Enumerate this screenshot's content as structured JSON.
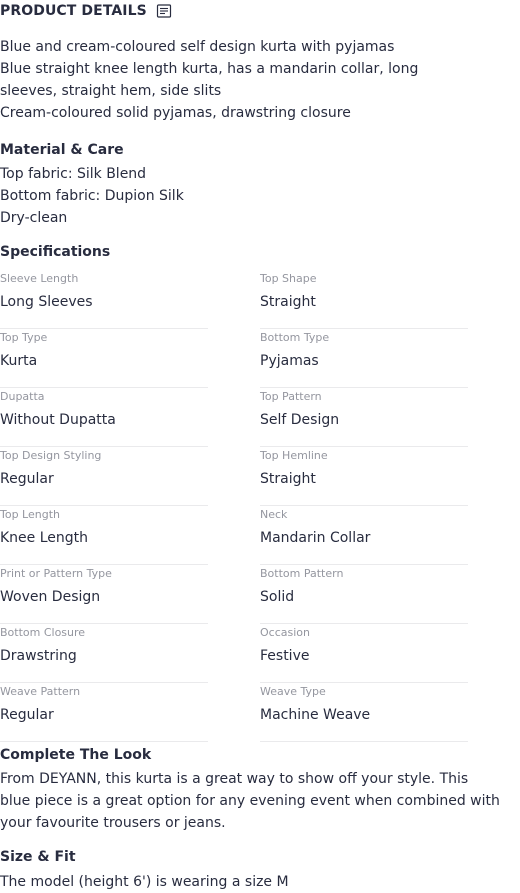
{
  "header": {
    "title": "PRODUCT DETAILS",
    "icon": "document-lines-icon"
  },
  "description": {
    "lines": [
      "Blue and cream-coloured self design kurta with pyjamas",
      "Blue straight knee length kurta, has a mandarin collar, long",
      "sleeves, straight hem, side slits",
      "Cream-coloured solid pyjamas, drawstring closure"
    ]
  },
  "material": {
    "title": "Material & Care",
    "items": [
      "Top fabric: Silk Blend",
      "Bottom fabric: Dupion Silk",
      "Dry-clean"
    ]
  },
  "specifications": {
    "title": "Specifications",
    "items": [
      {
        "label": "Sleeve Length",
        "value": "Long Sleeves"
      },
      {
        "label": "Top Shape",
        "value": "Straight"
      },
      {
        "label": "Top Type",
        "value": "Kurta"
      },
      {
        "label": "Bottom Type",
        "value": "Pyjamas"
      },
      {
        "label": "Dupatta",
        "value": "Without Dupatta"
      },
      {
        "label": "Top Pattern",
        "value": "Self Design"
      },
      {
        "label": "Top Design Styling",
        "value": "Regular"
      },
      {
        "label": "Top Hemline",
        "value": "Straight"
      },
      {
        "label": "Top Length",
        "value": "Knee Length"
      },
      {
        "label": "Neck",
        "value": "Mandarin Collar"
      },
      {
        "label": "Print or Pattern Type",
        "value": "Woven Design"
      },
      {
        "label": "Bottom Pattern",
        "value": "Solid"
      },
      {
        "label": "Bottom Closure",
        "value": "Drawstring"
      },
      {
        "label": "Occasion",
        "value": "Festive"
      },
      {
        "label": "Weave Pattern",
        "value": "Regular"
      },
      {
        "label": "Weave Type",
        "value": "Machine Weave"
      }
    ]
  },
  "complete_look": {
    "title": "Complete The Look",
    "lines": [
      "From DEYANN, this kurta is a great way to show off your style. This",
      "blue piece is a great option for any evening event when combined with",
      "your favourite trousers or jeans."
    ]
  },
  "size_fit": {
    "title": "Size & Fit",
    "text": "The model (height 6') is wearing a size M"
  },
  "colors": {
    "text": "#282c3f",
    "label": "#94969f",
    "divider": "#eaeaec"
  }
}
